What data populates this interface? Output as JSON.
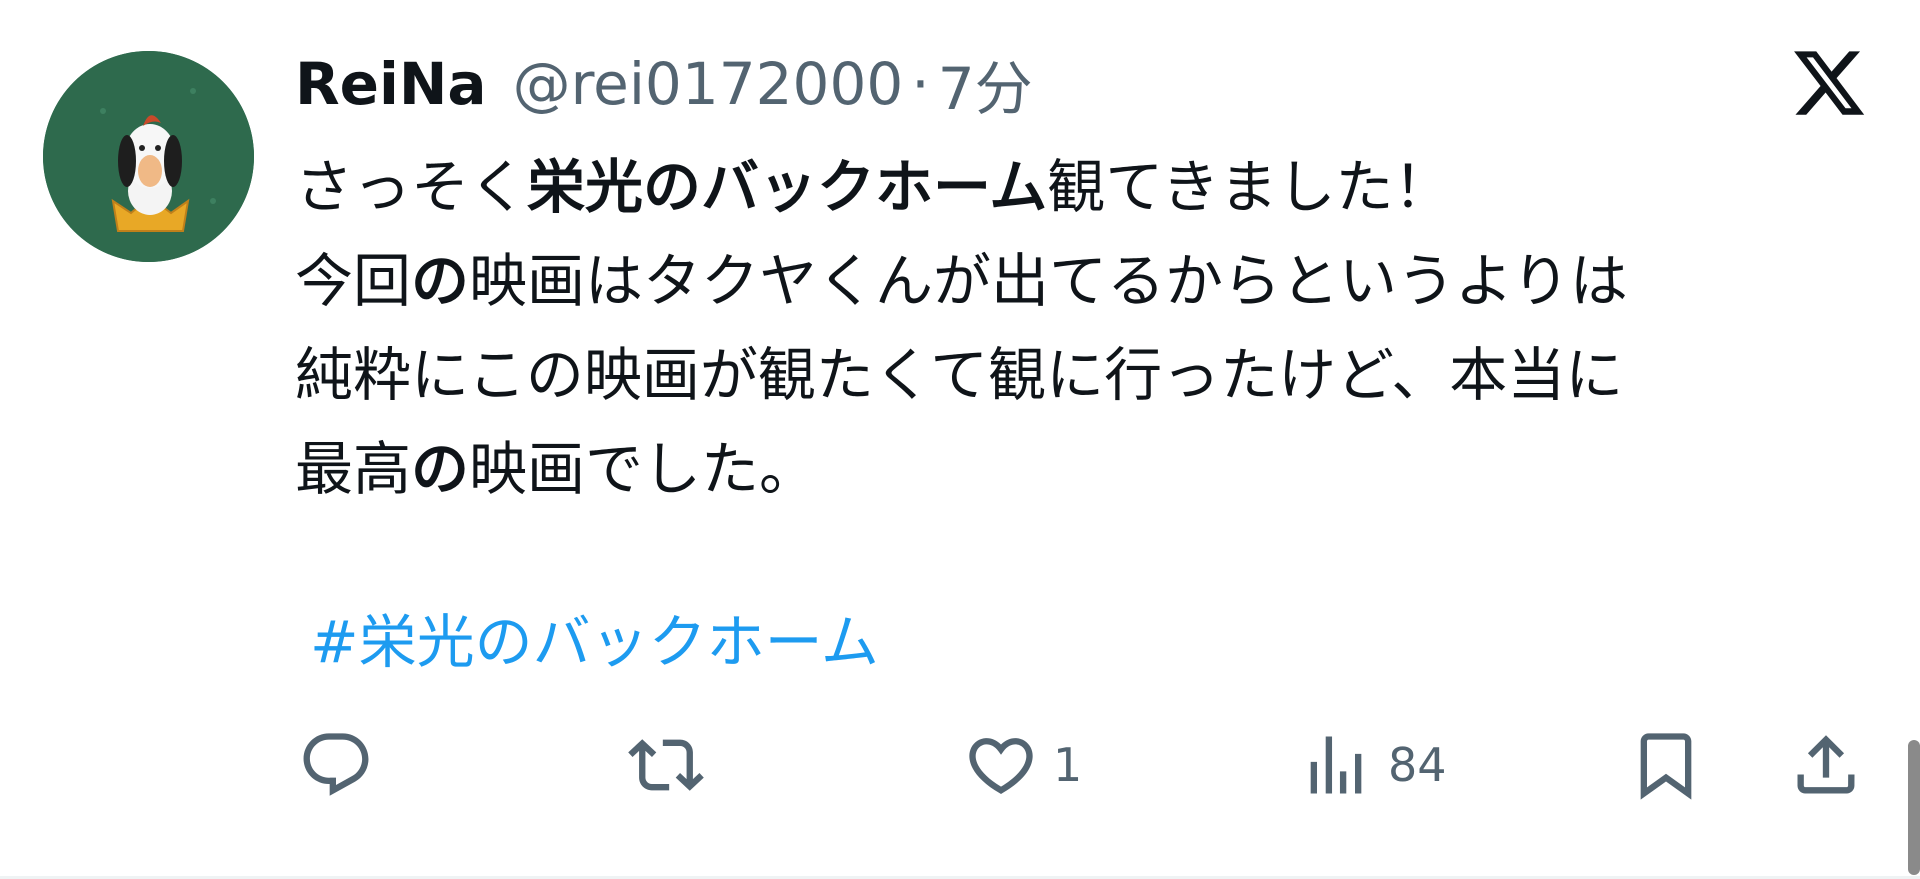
{
  "tweet": {
    "author": {
      "display_name": "ReiNa",
      "handle": "@rei0172000",
      "separator": "·",
      "time": "7分",
      "avatar_icon": "avatar-image"
    },
    "text_lines": [
      [
        {
          "text": "さっそく",
          "bold": false
        },
        {
          "text": "栄光のバックホーム",
          "bold": true
        },
        {
          "text": "観てきました！",
          "bold": false
        }
      ],
      [
        {
          "text": "今回",
          "bold": false
        },
        {
          "text": "の",
          "bold": true
        },
        {
          "text": "映画はタクヤくんが出てるからというよりは",
          "bold": false
        }
      ],
      [
        {
          "text": "純粋にこの映画が観たくて観に行ったけど、本当に",
          "bold": false
        }
      ],
      [
        {
          "text": "最高",
          "bold": false
        },
        {
          "text": "の",
          "bold": true
        },
        {
          "text": "映画でした。",
          "bold": false
        }
      ]
    ],
    "hashtag": "#栄光のバックホーム",
    "actions": {
      "reply": {
        "icon": "reply-icon",
        "count": ""
      },
      "retweet": {
        "icon": "retweet-icon",
        "count": ""
      },
      "like": {
        "icon": "heart-icon",
        "count": "1"
      },
      "views": {
        "icon": "views-icon",
        "count": "84"
      },
      "bookmark": {
        "icon": "bookmark-icon"
      },
      "share": {
        "icon": "share-icon"
      }
    }
  },
  "platform_logo": "x-logo-icon",
  "colors": {
    "text": "#0f1419",
    "secondary": "#536471",
    "link": "#1d9bf0",
    "background": "#ffffff"
  }
}
